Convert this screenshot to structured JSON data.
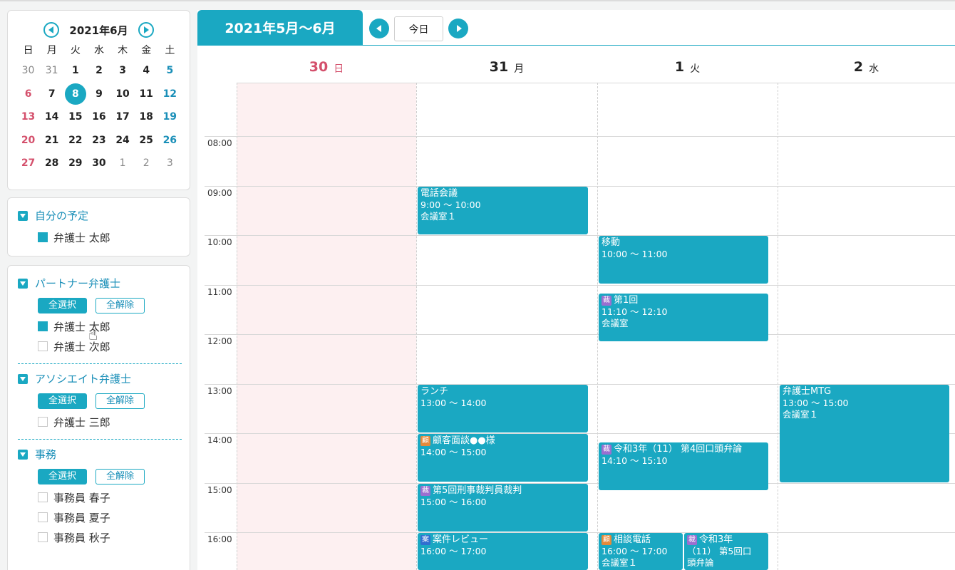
{
  "mini_calendar": {
    "title": "2021年6月",
    "weekdays": [
      "日",
      "月",
      "火",
      "水",
      "木",
      "金",
      "土"
    ],
    "weeks": [
      [
        "30",
        "31",
        "1",
        "2",
        "3",
        "4",
        "5"
      ],
      [
        "6",
        "7",
        "8",
        "9",
        "10",
        "11",
        "12"
      ],
      [
        "13",
        "14",
        "15",
        "16",
        "17",
        "18",
        "19"
      ],
      [
        "20",
        "21",
        "22",
        "23",
        "24",
        "25",
        "26"
      ],
      [
        "27",
        "28",
        "29",
        "30",
        "1",
        "2",
        "3"
      ]
    ]
  },
  "sidebar": {
    "own": {
      "title": "自分の予定",
      "items": [
        "弁護士 太郎"
      ]
    },
    "groups": [
      {
        "title": "パートナー弁護士",
        "select_all": "全選択",
        "clear_all": "全解除",
        "items": [
          "弁護士 太郎",
          "弁護士 次郎"
        ]
      },
      {
        "title": "アソシエイト弁護士",
        "select_all": "全選択",
        "clear_all": "全解除",
        "items": [
          "弁護士 三郎"
        ]
      },
      {
        "title": "事務",
        "select_all": "全選択",
        "clear_all": "全解除",
        "items": [
          "事務員 春子",
          "事務員 夏子",
          "事務員 秋子"
        ]
      }
    ]
  },
  "calendar": {
    "range_title": "2021年5月～6月",
    "today_label": "今日",
    "days": [
      {
        "num": "30",
        "weekday": "日"
      },
      {
        "num": "31",
        "weekday": "月"
      },
      {
        "num": "1",
        "weekday": "火"
      },
      {
        "num": "2",
        "weekday": "水"
      }
    ],
    "times": [
      "08:00",
      "09:00",
      "10:00",
      "11:00",
      "12:00",
      "13:00",
      "14:00",
      "15:00",
      "16:00"
    ],
    "events": [
      {
        "title": "電話会議",
        "time": "9:00 ～ 10:00",
        "place": "会議室１"
      },
      {
        "title": "移動",
        "time": "10:00 ～ 11:00",
        "place": ""
      },
      {
        "badge": "裁",
        "title": "第1回",
        "time": "11:10 ～ 12:10",
        "place": "会議室"
      },
      {
        "title": "ランチ",
        "time": "13:00 ～ 14:00",
        "place": ""
      },
      {
        "title": "弁護士MTG",
        "time": "13:00 ～ 15:00",
        "place": "会議室１"
      },
      {
        "badge": "顧",
        "title": "顧客面談●●様",
        "time": "14:00 ～ 15:00",
        "place": ""
      },
      {
        "badge": "裁",
        "title": "令和3年（11） 第4回口頭弁論",
        "time": "14:10 ～ 15:10",
        "place": ""
      },
      {
        "badge": "裁",
        "title": "第5回刑事裁判員裁判",
        "time": "15:00 ～ 16:00",
        "place": ""
      },
      {
        "badge": "案",
        "title": "案件レビュー",
        "time": "16:00 ～ 17:00",
        "place": ""
      },
      {
        "badge": "顧",
        "title": "相談電話",
        "time": "16:00 ～ 17:00",
        "place": "会議室１"
      },
      {
        "badge": "裁",
        "title": "令和3年",
        "time": "（11） 第5回口",
        "place": "頭弁論"
      }
    ]
  },
  "colors": {
    "accent": "#1aa8c2",
    "sunday": "#d4506c",
    "saturday": "#1a8fb8"
  }
}
